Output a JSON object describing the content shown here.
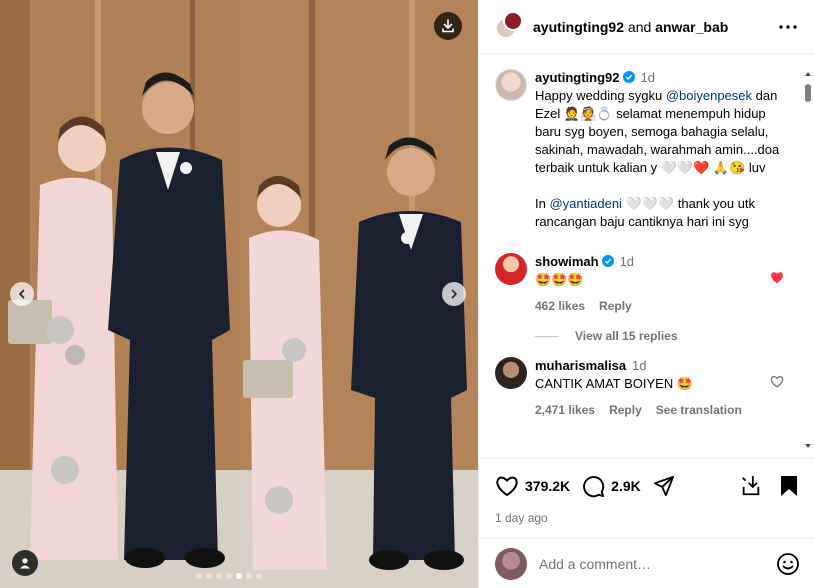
{
  "header": {
    "user1": "ayutingting92",
    "and_text": "and",
    "user2": "anwar_bab"
  },
  "caption": {
    "username": "ayutingting92",
    "time": "1d",
    "text_1": "Happy wedding sygku ",
    "mention_1": "@boiyenpesek",
    "text_2": " dan Ezel 🤵👰💍 selamat menempuh hidup baru syg boyen, semoga bahagia selalu, sakinah, mawadah, warahmah amin....doa terbaik untuk kalian y 🤍🤍❤️ 🙏😘 luv",
    "text_3": "In ",
    "mention_2": "@yantiadeni",
    "text_4": " 🤍🤍🤍 thank you utk rancangan baju cantiknya hari ini syg"
  },
  "comments": [
    {
      "username": "showimah",
      "time": "1d",
      "text": "🤩🤩🤩",
      "likes": "462 likes",
      "reply": "Reply",
      "view_replies": "View all 15 replies"
    },
    {
      "username": "muharismalisa",
      "time": "1d",
      "text": "CANTIK AMAT BOIYEN 🤩",
      "likes": "2,471 likes",
      "reply": "Reply",
      "translate": "See translation"
    }
  ],
  "actions": {
    "likes": "379.2K",
    "comments": "2.9K",
    "date": "1 day ago"
  },
  "add_comment": {
    "placeholder": "Add a comment…"
  },
  "carousel": {
    "total_slides": 7,
    "active_index": 4
  },
  "colors": {
    "like_red": "#ff3040",
    "verified_blue": "#0095f6",
    "mention_blue": "#00376b",
    "muted_gray": "#737373"
  }
}
